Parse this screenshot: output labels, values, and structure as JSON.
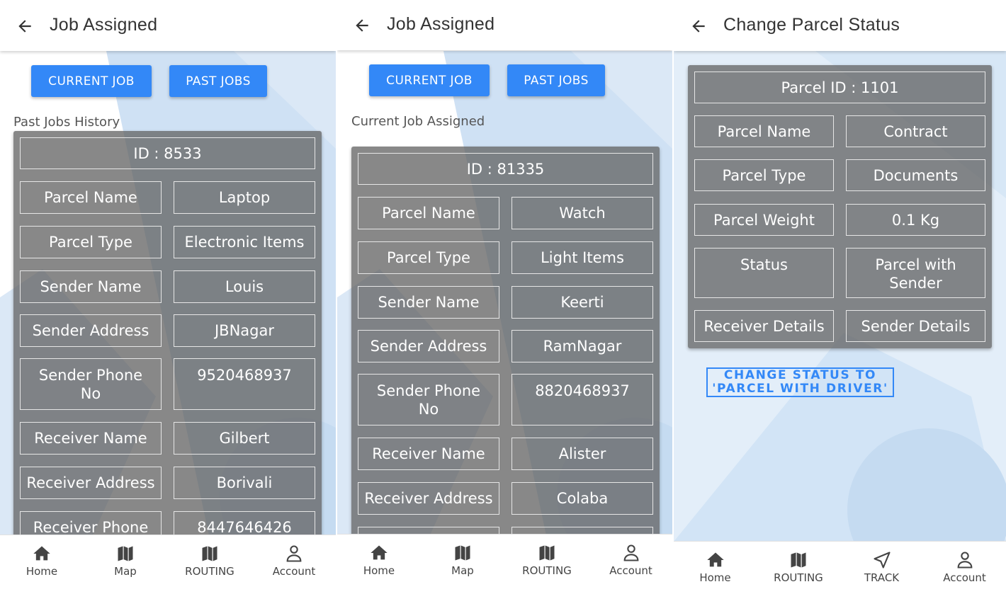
{
  "panels": [
    {
      "appbar": {
        "title": "Job Assigned"
      },
      "tabs": {
        "current": "CURRENT JOB",
        "past": "PAST JOBS"
      },
      "section_label": "Past Jobs History",
      "job": {
        "id": "ID : 8533",
        "rows": [
          {
            "label": "Parcel Name",
            "value": "Laptop"
          },
          {
            "label": "Parcel Type",
            "value": "Electronic Items"
          },
          {
            "label": "Sender Name",
            "value": "Louis"
          },
          {
            "label": "Sender Address",
            "value": "JBNagar"
          },
          {
            "label": "Sender Phone No",
            "value": "9520468937"
          },
          {
            "label": "Receiver Name",
            "value": "Gilbert"
          },
          {
            "label": "Receiver Address",
            "value": "Borivali"
          },
          {
            "label": "Receiver Phone",
            "value": "8447646426"
          }
        ]
      },
      "nav": [
        {
          "label": "Home",
          "icon": "home-icon"
        },
        {
          "label": "Map",
          "icon": "map-icon"
        },
        {
          "label": "ROUTING",
          "icon": "map-icon"
        },
        {
          "label": "Account",
          "icon": "account-icon"
        }
      ]
    },
    {
      "appbar": {
        "title": "Job Assigned"
      },
      "tabs": {
        "current": "CURRENT JOB",
        "past": "PAST JOBS"
      },
      "section_label": "Current Job Assigned",
      "job": {
        "id": "ID : 81335",
        "rows": [
          {
            "label": "Parcel Name",
            "value": "Watch"
          },
          {
            "label": "Parcel Type",
            "value": "Light Items"
          },
          {
            "label": "Sender Name",
            "value": "Keerti"
          },
          {
            "label": "Sender Address",
            "value": "RamNagar"
          },
          {
            "label": "Sender Phone No",
            "value": "8820468937"
          },
          {
            "label": "Receiver Name",
            "value": "Alister"
          },
          {
            "label": "Receiver Address",
            "value": "Colaba"
          },
          {
            "label": "",
            "value": ""
          }
        ]
      },
      "nav": [
        {
          "label": "Home",
          "icon": "home-icon"
        },
        {
          "label": "Map",
          "icon": "map-icon"
        },
        {
          "label": "ROUTING",
          "icon": "map-icon"
        },
        {
          "label": "Account",
          "icon": "account-icon"
        }
      ]
    },
    {
      "appbar": {
        "title": "Change Parcel Status"
      },
      "parcel": {
        "id": "Parcel ID : 1101",
        "rows": [
          {
            "label": "Parcel Name",
            "value": "Contract"
          },
          {
            "label": "Parcel Type",
            "value": "Documents"
          },
          {
            "label": "Parcel Weight",
            "value": "0.1 Kg"
          },
          {
            "label": "Status",
            "value": "Parcel with Sender"
          },
          {
            "label": "Receiver Details",
            "value": "Sender Details"
          }
        ]
      },
      "change_status_button": "CHANGE STATUS TO 'PARCEL WITH DRIVER'",
      "nav": [
        {
          "label": "Home",
          "icon": "home-icon"
        },
        {
          "label": "ROUTING",
          "icon": "map-icon"
        },
        {
          "label": "TRACK",
          "icon": "navigation-arrow-icon"
        },
        {
          "label": "Account",
          "icon": "account-icon"
        }
      ]
    }
  ],
  "colors": {
    "accent": "#3388f7",
    "card": "#606060",
    "background_shape": "#cfe1f4"
  }
}
